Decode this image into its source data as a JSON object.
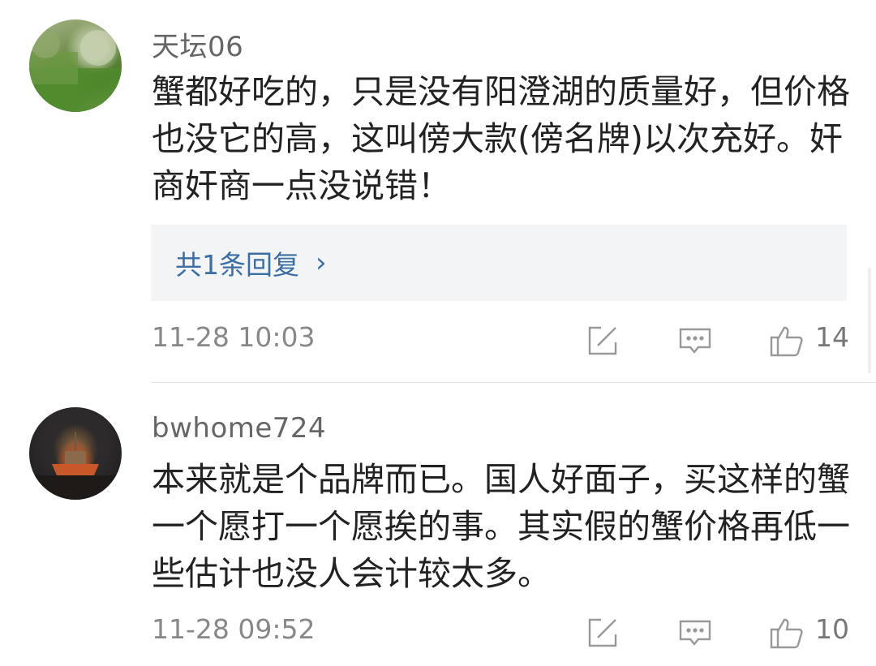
{
  "comments": [
    {
      "username": "天坛06",
      "text": "蟹都好吃的，只是没有阳澄湖的质量好，但价格也没它的高，这叫傍大款(傍名牌)以次充好。奸商奸商一点没说错！",
      "replies_label": "共1条回复",
      "reply_chevron": "›",
      "time": "11-28 10:03",
      "likes": "14",
      "avatar_icon": "landscape-photo-icon"
    },
    {
      "username": "bwhome724",
      "text": "本来就是个品牌而已。国人好面子，买这样的蟹一个愿打一个愿挨的事。其实假的蟹价格再低一些估计也没人会计较太多。",
      "time": "11-28 09:52",
      "likes": "10",
      "avatar_icon": "boat-photo-icon"
    }
  ],
  "icons": {
    "share": "share-edit-icon",
    "comment": "comment-bubble-icon",
    "like": "thumbs-up-icon"
  },
  "colors": {
    "username": "#666666",
    "text": "#222222",
    "link": "#3a6ea5",
    "meta": "#888888",
    "reply_bg": "#f3f4f6"
  }
}
